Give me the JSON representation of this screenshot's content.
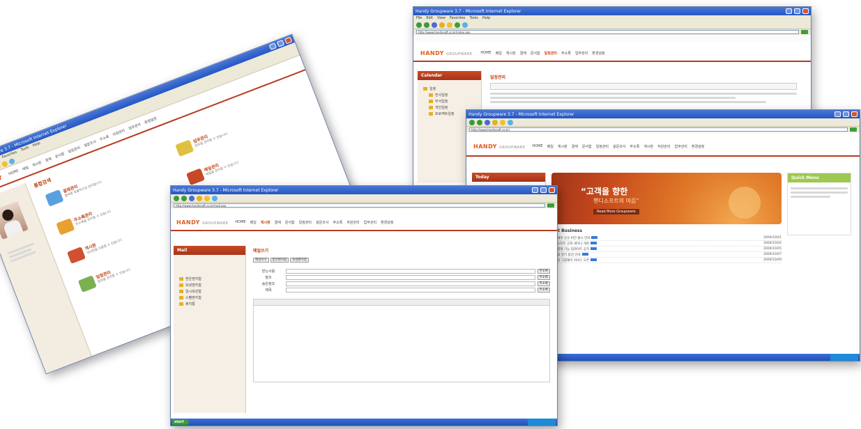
{
  "brand": {
    "logo_main": "HANDY",
    "logo_sub": "GROUPWARE"
  },
  "windows": {
    "w1": {
      "title": "Handy Groupware 3.7 - Microsoft Internet Explorer",
      "menu": [
        "File",
        "Edit",
        "View",
        "Favorites",
        "Tools",
        "Help"
      ],
      "gnb": [
        "HOME",
        "메일",
        "게시판",
        "결재",
        "문서함",
        "일정관리",
        "설문조사",
        "주소록",
        "자원관리",
        "업무관리",
        "환경설정"
      ],
      "section_title": "통합검색",
      "tiles": [
        {
          "t": "결재관리",
          "d": "결재를 효율적으로 관리합니다"
        },
        {
          "t": "주소록관리",
          "d": "주소록을 관리할 수 있습니다"
        },
        {
          "t": "게시판",
          "d": "게시판을 이용할 수 있습니다"
        },
        {
          "t": "일정관리",
          "d": "일정을 관리할 수 있습니다"
        },
        {
          "t": "업무관리",
          "d": "업무를 관리할 수 있습니다"
        },
        {
          "t": "메일관리",
          "d": "메일을 관리할 수 있습니다"
        },
        {
          "t": "설문조사",
          "d": "설문을 작성할 수 있습니다"
        }
      ]
    },
    "w2": {
      "title": "Handy Groupware 3.7 - Microsoft Internet Explorer",
      "menu": [
        "File",
        "Edit",
        "View",
        "Favorites",
        "Tools",
        "Help"
      ],
      "address": "http://www.handysoft.co.kr/index.asp",
      "gnb": [
        "HOME",
        "메일",
        "게시판",
        "결재",
        "문서함",
        "일정관리",
        "주소록",
        "업무관리",
        "환경설정"
      ],
      "active": "일정관리",
      "lnb_head": "Calendar",
      "content_title": "일정관리",
      "tree": [
        "일정",
        "전사일정",
        "부서일정",
        "개인일정",
        "프로젝트일정"
      ]
    },
    "w3": {
      "title": "Handy Groupware 3.7 - Microsoft Internet Explorer",
      "address": "http://www.handysoft.co.kr/",
      "gnb": [
        "HOME",
        "메일",
        "게시판",
        "결재",
        "문서함",
        "일정관리",
        "설문조사",
        "주소록",
        "게시판",
        "자원관리",
        "업무관리",
        "환경설정"
      ],
      "banner_main": "“고객을 향한",
      "banner_sub": "핸디소프트의 마음”",
      "banner_btn": "Read More Groupware",
      "side_head": "Today",
      "news_title": "Hot Business",
      "right_box": "Quick Menu",
      "news": [
        {
          "t": "그룹웨어 신규 버전 출시 안내",
          "d": "2009/10/01"
        },
        {
          "t": "핸디소프트 고객 세미나 개최",
          "d": "2009/10/02"
        },
        {
          "t": "전자결재 기능 업데이트 공지",
          "d": "2009/10/05"
        },
        {
          "t": "시스템 정기 점검 안내",
          "d": "2009/10/07"
        },
        {
          "t": "모바일 그룹웨어 서비스 오픈",
          "d": "2009/10/09"
        }
      ]
    },
    "w4": {
      "title": "Handy Groupware 3.7 - Microsoft Internet Explorer",
      "address": "http://www.handysoft.co.kr/mail.asp",
      "gnb": [
        "HOME",
        "메일",
        "게시판",
        "결재",
        "문서함",
        "일정관리",
        "설문조사",
        "주소록",
        "자원관리",
        "업무관리",
        "환경설정"
      ],
      "active": "게시판",
      "lnb_head": "Mail",
      "content_title": "메일쓰기",
      "tabs": [
        "메일쓰기",
        "받은편지함",
        "보낸편지함"
      ],
      "fields": [
        "받는사람",
        "참조",
        "숨은참조",
        "제목"
      ],
      "field_btn": "주소록",
      "folders": [
        "받은편지함",
        "보낸편지함",
        "임시보관함",
        "스팸편지함",
        "휴지통"
      ]
    }
  }
}
